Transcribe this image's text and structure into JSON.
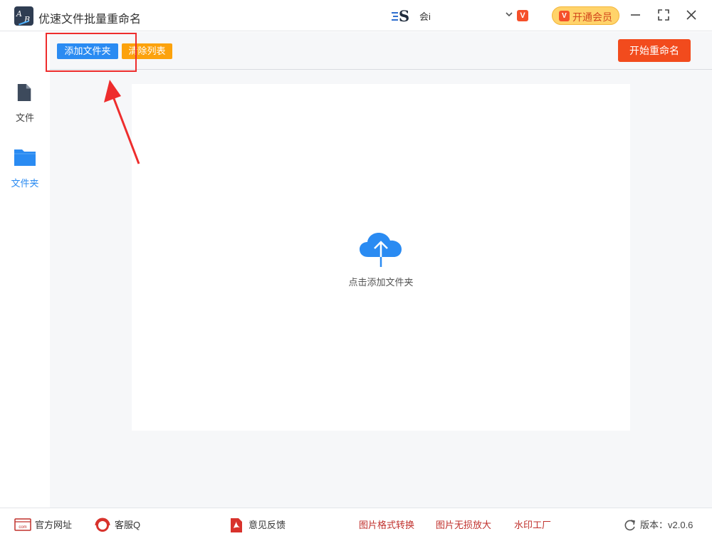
{
  "app": {
    "title": "优速文件批量重命名"
  },
  "account": {
    "user_name": "会i",
    "vip_button_label": "开通会员"
  },
  "toolbar": {
    "add_folder_label": "添加文件夹",
    "clear_list_label": "清除列表",
    "start_rename_label": "开始重命名"
  },
  "sidebar": {
    "items": [
      {
        "label": "文件",
        "icon": "file-icon",
        "active": false
      },
      {
        "label": "文件夹",
        "icon": "folder-icon",
        "active": true
      }
    ]
  },
  "dropzone": {
    "label": "点击添加文件夹",
    "icon": "cloud-upload-icon"
  },
  "footer": {
    "website_label": "官方网址",
    "service_label": "客服Q",
    "feedback_label": "意见反馈",
    "links": [
      "图片格式转换",
      "图片无损放大",
      "水印工厂"
    ],
    "version_label": "版本：v2.0.6"
  },
  "colors": {
    "accent_blue": "#2a8bf2",
    "clear_orange": "#fca20c",
    "start_red": "#f24b1d",
    "annotation_red": "#ee2d2d",
    "footer_link_red": "#c0302c"
  }
}
